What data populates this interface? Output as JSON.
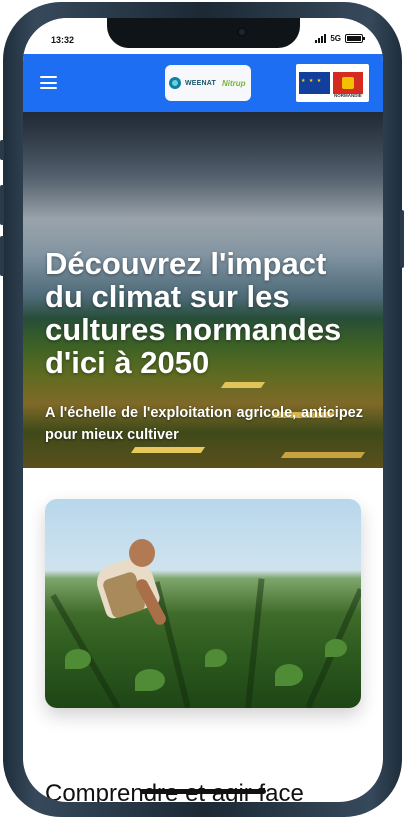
{
  "status_bar": {
    "time": "13:32",
    "network": "5G"
  },
  "header": {
    "menu_icon": "hamburger-menu-icon",
    "partner_logo_left": "WEENAT",
    "partner_logo_right": "Nitrup",
    "funder_logo_label": "NORMANDIE",
    "color": "#1e6ef4"
  },
  "hero": {
    "title": "Découvrez l'impact du climat sur les cultures normandes d'ici à 2050",
    "subtitle": "A l'échelle de l'exploitation agricole, anticipez pour mieux cultiver"
  },
  "section": {
    "heading": "Comprendre et agir face"
  }
}
